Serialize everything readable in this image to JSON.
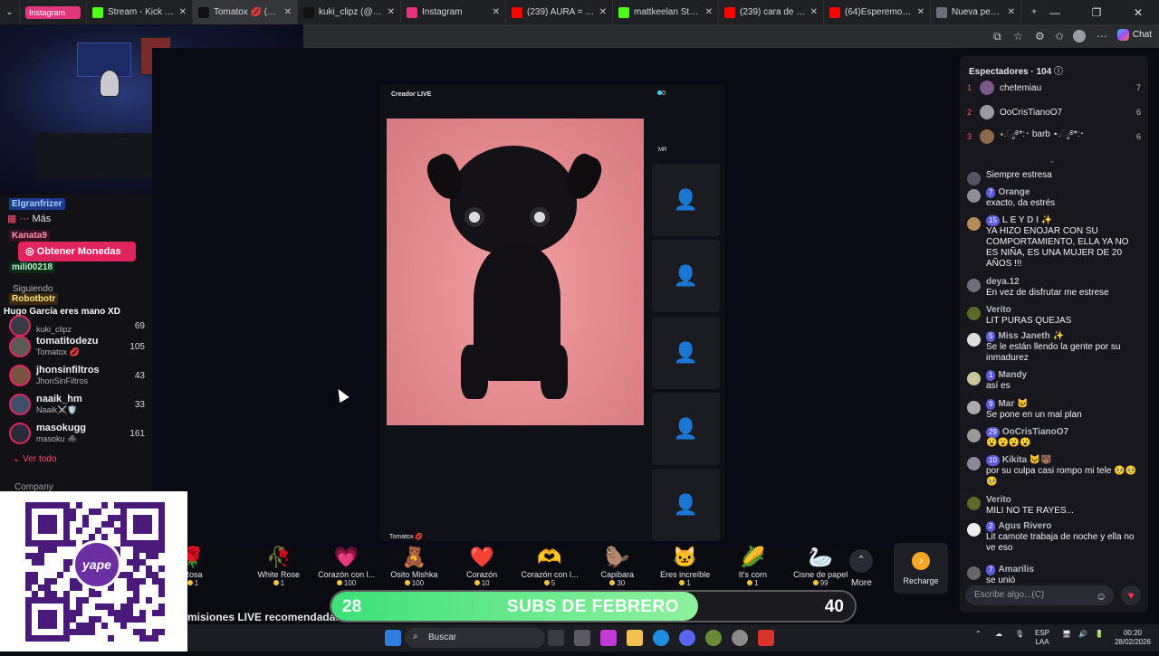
{
  "browser": {
    "tabs": [
      {
        "title": "Instagram",
        "chip": true,
        "color": "#e3357a"
      },
      {
        "title": "Stream - Kick Dashboard",
        "color": "#53fc18"
      },
      {
        "title": "Tomatox 💋 (@tomatox)",
        "color": "#111111",
        "active": true
      },
      {
        "title": "kuki_clipz (@kuki_clipz)",
        "color": "#111111"
      },
      {
        "title": "Instagram",
        "color": "#e3357a"
      },
      {
        "title": "(239) AURA = ∞ | 1 H",
        "color": "#ff0000"
      },
      {
        "title": "mattkeelan Stream - V",
        "color": "#53fc18"
      },
      {
        "title": "(239) cara de payaso",
        "color": "#ff0000"
      },
      {
        "title": "(64)Esperemos que se",
        "color": "#ff0000"
      },
      {
        "title": "Nueva pestaña",
        "color": "#6e6e78"
      }
    ],
    "chat_button": "Chat"
  },
  "sidebar": {
    "floating_labels": [
      "Elgranfrizer",
      "Kanata9",
      "mili00218",
      "Robotbotr"
    ],
    "more": "Más",
    "coins_button": "Obtener Monedas",
    "following": "Siguiendo",
    "chat_overlay_line": "Hugo García eres mano XD",
    "streamers": [
      {
        "name": "kuki_clipz",
        "sub": "kuki_clipz",
        "count": "69"
      },
      {
        "name": "tomatitodezu",
        "sub": "Tomatox 💋",
        "count": "105"
      },
      {
        "name": "jhonsinfiltros",
        "sub": "JhonSinFiltros",
        "count": "43"
      },
      {
        "name": "naaik_hm",
        "sub": "Naaik⚔️🛡️",
        "count": "33"
      },
      {
        "name": "masokugg",
        "sub": "masoku 🕷️",
        "count": "161"
      }
    ],
    "see_all": "Ver todo",
    "company": "Company"
  },
  "stage": {
    "creator_label": "Creador LIVE",
    "viewers_dot": "0",
    "mini_label": "MR",
    "host_label": "Tomatox 💋",
    "recommended": "misiones LIVE recomendadas"
  },
  "gifts": [
    {
      "name": "Rosa",
      "price": "1",
      "icon": "🌹"
    },
    {
      "name": "White Rose",
      "price": "1",
      "icon": "🥀"
    },
    {
      "name": "Corazón con l...",
      "price": "100",
      "icon": "💗"
    },
    {
      "name": "Osito Mishka",
      "price": "100",
      "icon": "🧸"
    },
    {
      "name": "Corazón",
      "price": "10",
      "icon": "❤️"
    },
    {
      "name": "Corazón con l...",
      "price": "5",
      "icon": "🫶"
    },
    {
      "name": "Capibara",
      "price": "30",
      "icon": "🦫"
    },
    {
      "name": "Eres increíble",
      "price": "1",
      "icon": "🐱"
    },
    {
      "name": "It's corn",
      "price": "1",
      "icon": "🌽"
    },
    {
      "name": "Cisne de papel",
      "price": "99",
      "icon": "🦢"
    }
  ],
  "gift_more": "More",
  "recharge": "Recharge",
  "goal": {
    "current": "28",
    "target": "40",
    "title": "SUBS DE FEBRERO",
    "progress": 0.7
  },
  "viewers_panel": {
    "title": "Espectadores",
    "count": "104",
    "top": [
      {
        "rank": "1",
        "name": "chetemiau",
        "score": "7"
      },
      {
        "rank": "2",
        "name": "OoCrisTianoO7",
        "score": "6"
      },
      {
        "rank": "3",
        "name": "⋆.ೃ࿔*:･ barb ⋆.ೃ࿔*:･",
        "score": "6"
      }
    ]
  },
  "chat": [
    {
      "user": "",
      "level": "",
      "text": "Siempre estresa"
    },
    {
      "user": "Orange",
      "level": "7",
      "text": "exacto, da estrés"
    },
    {
      "user": "L E Y D I ✨",
      "level": "15",
      "text": "YA HIZO ENOJAR CON SU COMPORTAMIENTO, ELLA YA NO ES NIÑA, ES UNA MUJER DE 20 AÑOS !!!"
    },
    {
      "user": "deya.12",
      "level": "",
      "text": "En vez de disfrutar me estrese"
    },
    {
      "user": "Verito",
      "level": "",
      "text": "LIT PURAS QUEJAS"
    },
    {
      "user": "Miss Janeth ✨",
      "level": "5",
      "text": "Se le están llendo la gente por su inmadurez"
    },
    {
      "user": "Mandy",
      "level": "1",
      "text": "así es"
    },
    {
      "user": "Mar 🐱",
      "level": "9",
      "text": "Se pone en un mal plan"
    },
    {
      "user": "OoCrisTianoO7",
      "level": "29",
      "text": "😮😮😮😮"
    },
    {
      "user": "Kikita 🐱🐻",
      "level": "10",
      "text": "por su culpa casi rompo mi tele 🥺🥺🥺"
    },
    {
      "user": "Verito",
      "level": "",
      "text": "MILI NO TE RAYES..."
    },
    {
      "user": "Agus Rivero",
      "level": "2",
      "text": "Lit camote trabaja de noche y ella no ve eso"
    },
    {
      "user": "Amarilis",
      "level": "7",
      "text": "se unió"
    }
  ],
  "chat_placeholder": "Escribe algo...(C)",
  "taskbar": {
    "search": "Buscar",
    "lang": "ESP",
    "region": "LAA",
    "time": "00:20",
    "date": "28/02/2026"
  },
  "qr": {
    "brand": "yape"
  }
}
